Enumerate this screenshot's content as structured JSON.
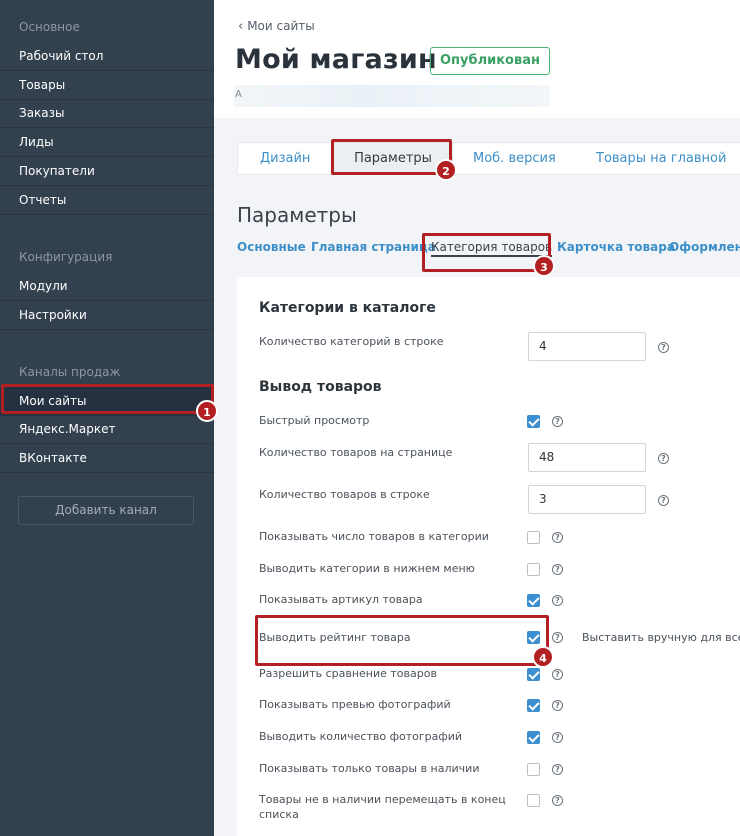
{
  "sidebar": {
    "sections": [
      "Основное",
      "Конфигурация",
      "Каналы продаж"
    ],
    "items_main": [
      "Рабочий стол",
      "Товары",
      "Заказы",
      "Лиды",
      "Покупатели",
      "Отчеты"
    ],
    "items_config": [
      "Модули",
      "Настройки"
    ],
    "items_channels": [
      "Мои сайты",
      "Яндекс.Маркет",
      "ВКонтакте"
    ],
    "add_channel": "Добавить канал"
  },
  "header": {
    "back": "Мои сайты",
    "title": "Мой магазин",
    "status": "Опубликован",
    "url_char": "А"
  },
  "tabs": [
    "Дизайн",
    "Параметры",
    "Моб. версия",
    "Товары на главной"
  ],
  "section_title": "Параметры",
  "subtabs": [
    "Основные",
    "Главная страница",
    "Категория товаров",
    "Карточка товара",
    "Оформлени"
  ],
  "panel": {
    "group1": "Категории в каталоге",
    "cats_per_row_label": "Количество категорий в строке",
    "cats_per_row": "4",
    "group2": "Вывод товаров",
    "rows": [
      {
        "label": "Быстрый просмотр",
        "checked": true
      },
      {
        "label": "Количество товаров на странице",
        "value": "48"
      },
      {
        "label": "Количество товаров в строке",
        "value": "3"
      },
      {
        "label": "Показывать число товаров в категории",
        "checked": false
      },
      {
        "label": "Выводить категории в нижнем меню",
        "checked": false
      },
      {
        "label": "Показывать артикул товара",
        "checked": true
      },
      {
        "label": "Выводить рейтинг товара",
        "checked": true
      },
      {
        "label": "Разрешить сравнение товаров",
        "checked": true
      },
      {
        "label": "Показывать превью фотографий",
        "checked": true
      },
      {
        "label": "Выводить количество фотографий",
        "checked": true
      },
      {
        "label": "Показывать только товары в наличии",
        "checked": false
      },
      {
        "label": "Товары не в наличии перемещать в конец списка",
        "checked": false
      }
    ],
    "rating_extra": "Выставить вручную для все"
  },
  "help_glyph": "?",
  "markers": [
    "1",
    "2",
    "3",
    "4"
  ],
  "colors": {
    "accent": "#3b8fd0",
    "highlight": "#b32024",
    "sidebar": "#33404e",
    "published": "#3a9f63"
  }
}
